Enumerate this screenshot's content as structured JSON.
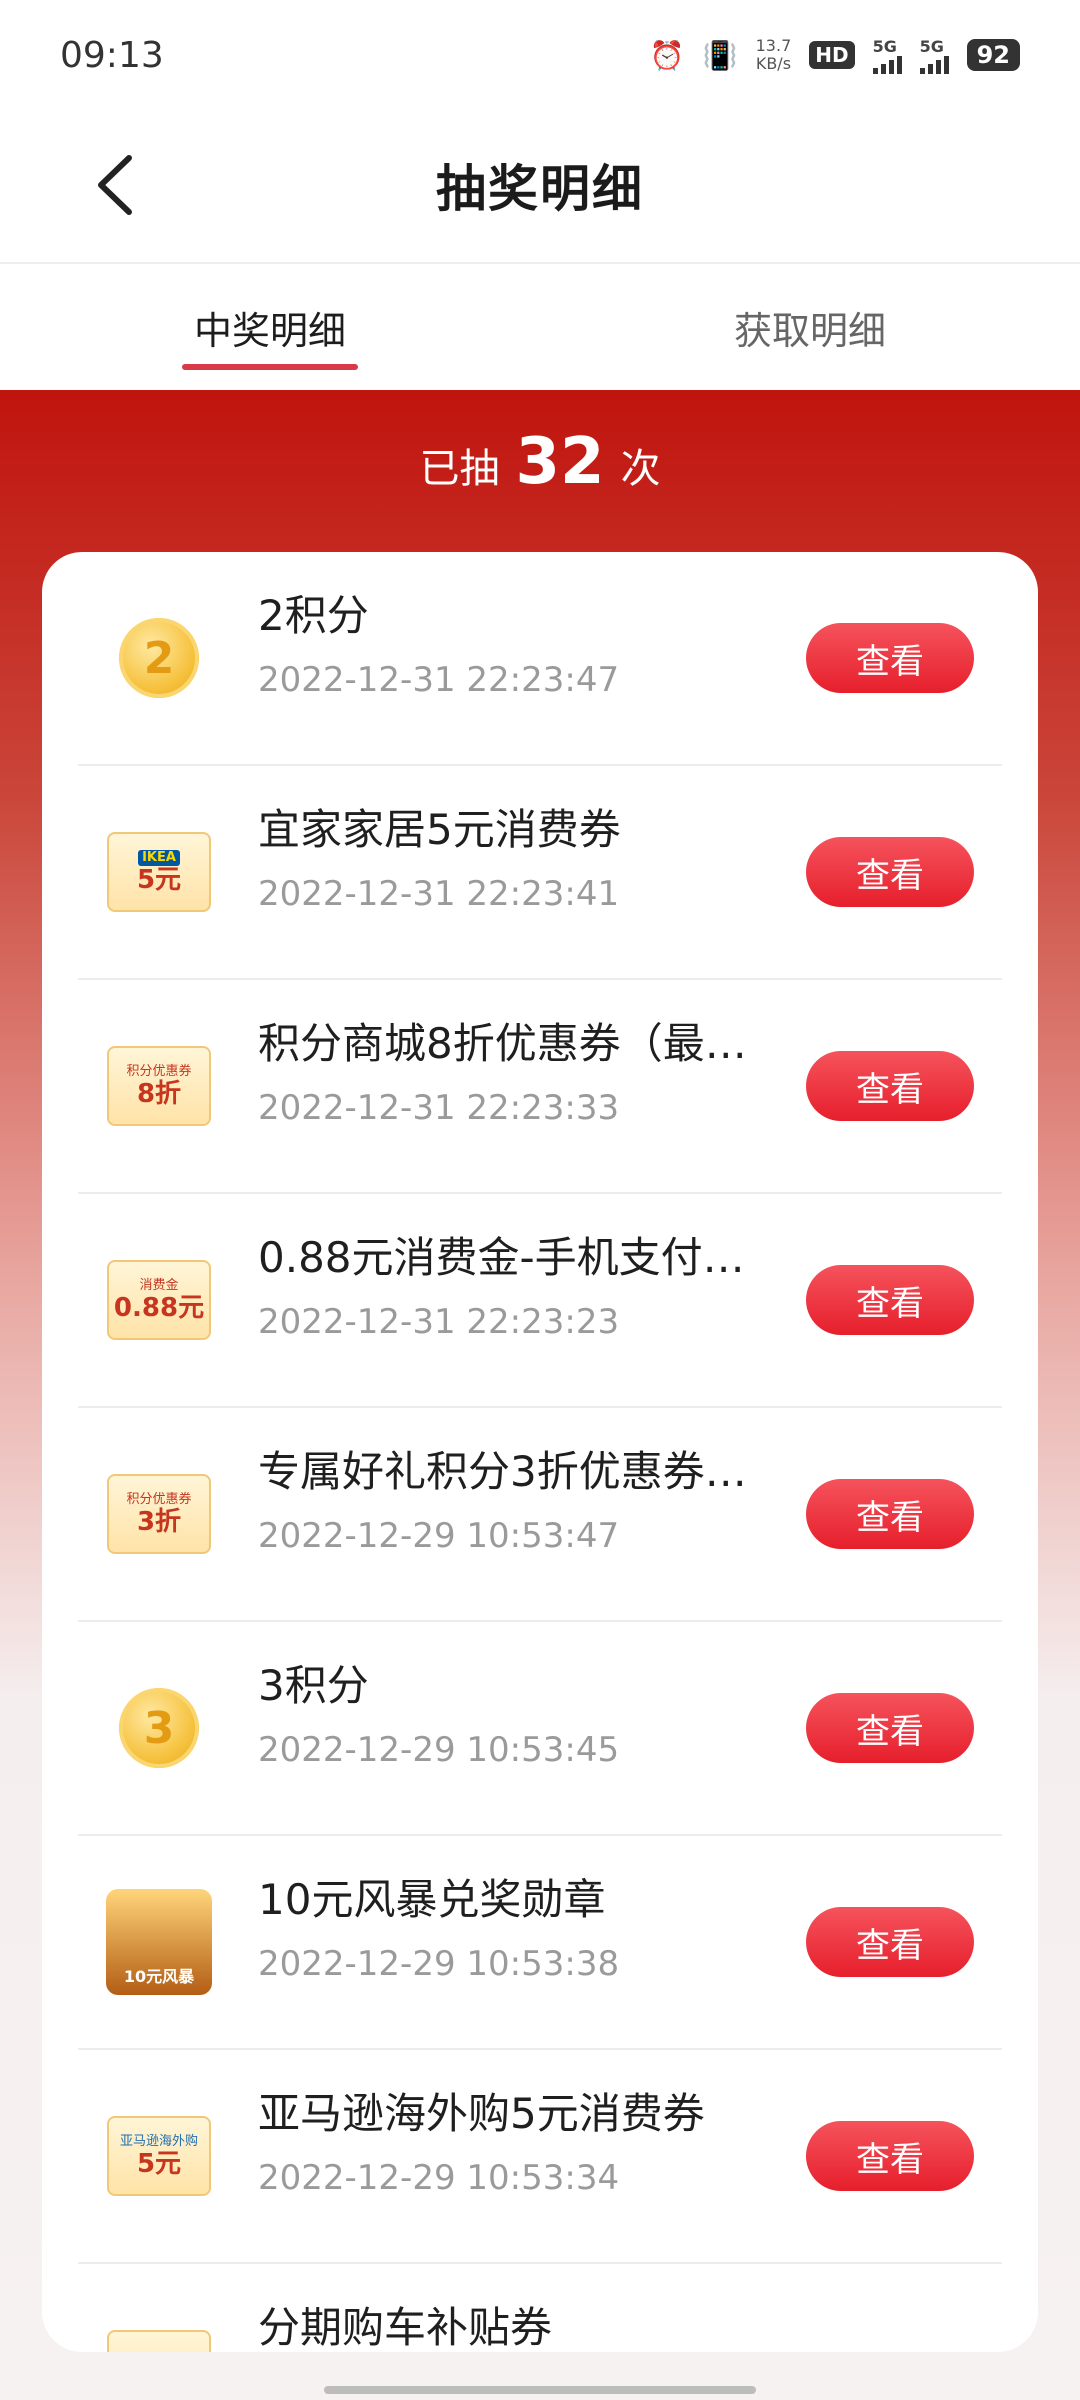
{
  "status_bar": {
    "time": "09:13",
    "net_speed_value": "13.7",
    "net_speed_unit": "KB/s",
    "hd_label": "HD",
    "sim1": "5G",
    "sim2": "5G",
    "battery": "92"
  },
  "header": {
    "title": "抽奖明细"
  },
  "tabs": [
    {
      "label": "中奖明细",
      "active": true
    },
    {
      "label": "获取明细",
      "active": false
    }
  ],
  "summary": {
    "prefix": "已抽",
    "count": "32",
    "suffix": "次"
  },
  "records": [
    {
      "name": "2积分",
      "time": "2022-12-31 22:23:47",
      "button": "查看",
      "thumb": "coin",
      "thumb_text": "2"
    },
    {
      "name": "宜家家居5元消费券",
      "time": "2022-12-31 22:23:41",
      "button": "查看",
      "thumb": "coupon",
      "thumb_top": "IKEA",
      "thumb_big": "5元"
    },
    {
      "name": "积分商城8折优惠券（最…",
      "time": "2022-12-31 22:23:33",
      "button": "查看",
      "thumb": "coupon",
      "thumb_top": "积分优惠券",
      "thumb_big": "8折"
    },
    {
      "name": "0.88元消费金-手机支付…",
      "time": "2022-12-31 22:23:23",
      "button": "查看",
      "thumb": "coupon",
      "thumb_top": "消费金",
      "thumb_big": "0.88元"
    },
    {
      "name": "专属好礼积分3折优惠券…",
      "time": "2022-12-29 10:53:47",
      "button": "查看",
      "thumb": "coupon",
      "thumb_top": "积分优惠券",
      "thumb_big": "3折"
    },
    {
      "name": "3积分",
      "time": "2022-12-29 10:53:45",
      "button": "查看",
      "thumb": "coin",
      "thumb_text": "3"
    },
    {
      "name": "10元风暴兑奖勋章",
      "time": "2022-12-29 10:53:38",
      "button": "查看",
      "thumb": "badge",
      "thumb_text": "10元风暴"
    },
    {
      "name": "亚马逊海外购5元消费券",
      "time": "2022-12-29 10:53:34",
      "button": "查看",
      "thumb": "coupon",
      "thumb_top": "亚马逊海外购",
      "thumb_big": "5元"
    },
    {
      "name": "分期购车补贴券",
      "time": "",
      "button": "",
      "thumb": "coupon",
      "thumb_top": "",
      "thumb_big": ""
    }
  ]
}
